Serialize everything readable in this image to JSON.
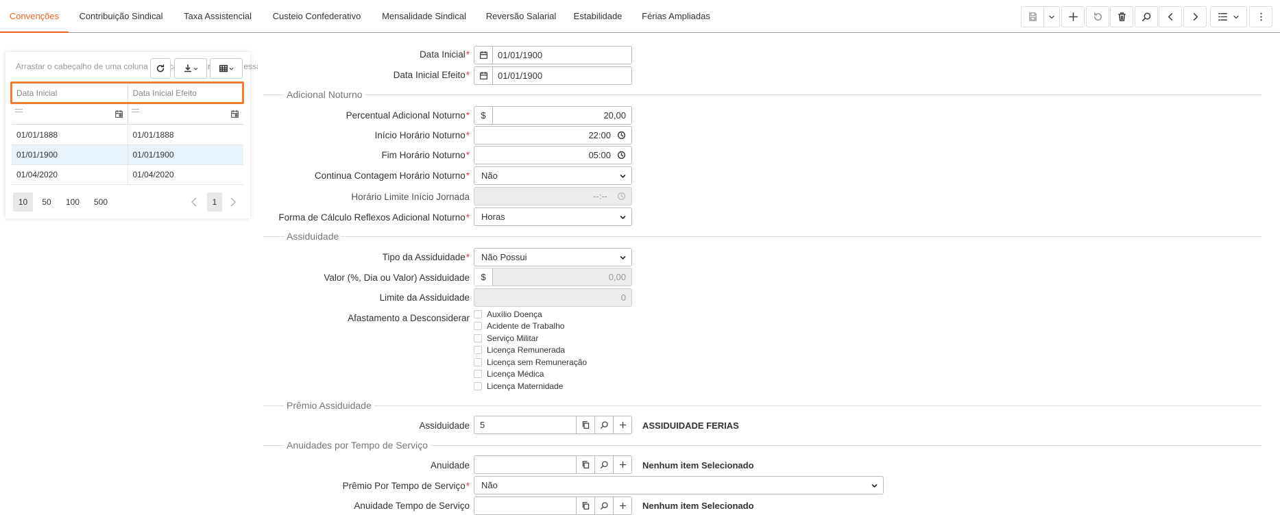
{
  "tabs": [
    "Convenções",
    "Contribuição Sindical",
    "Taxa Assistencial",
    "Custeio Confederativo",
    "Mensalidade Sindical",
    "Reversão Salarial",
    "Estabilidade",
    "Férias Ampliadas"
  ],
  "accent_color": "#f26522",
  "toolbar_icons": [
    "save-icon",
    "chevron-down-icon",
    "plus-icon",
    "undo-icon",
    "trash-icon",
    "search-icon",
    "chevron-left-icon",
    "chevron-right-icon",
    "list-icon",
    "chevron-down-icon",
    "more-vertical-icon"
  ],
  "grid": {
    "drag_hint": "Arrastar o cabeçalho de uma coluna para cá para agrupar por essa coluna",
    "columns": [
      "Data Inicial",
      "Data Inicial Efeito"
    ],
    "rows": [
      [
        "01/01/1888",
        "01/01/1888"
      ],
      [
        "01/01/1900",
        "01/01/1900"
      ],
      [
        "01/04/2020",
        "01/04/2020"
      ]
    ],
    "selected_row": 1,
    "page_sizes": [
      "10",
      "50",
      "100",
      "500"
    ],
    "current_page": "1"
  },
  "form": {
    "data_inicial": {
      "label": "Data Inicial",
      "value": "01/01/1900"
    },
    "data_inicial_efeito": {
      "label": "Data Inicial Efeito",
      "value": "01/01/1900"
    },
    "sec_adicional_noturno": "Adicional Noturno",
    "percentual": {
      "label": "Percentual Adicional Noturno",
      "prefix": "$",
      "value": "20,00"
    },
    "inicio_horario": {
      "label": "Início Horário Noturno",
      "value": "22:00"
    },
    "fim_horario": {
      "label": "Fim Horário Noturno",
      "value": "05:00"
    },
    "continua_contagem": {
      "label": "Continua Contagem Horário Noturno",
      "value": "Não"
    },
    "horario_limite": {
      "label": "Horário Limite Início Jornada",
      "value": "--:--"
    },
    "forma_calculo": {
      "label": "Forma de Cálculo Reflexos Adicional Noturno",
      "value": "Horas"
    },
    "sec_assiduidade": "Assiduidade",
    "tipo_assiduidade": {
      "label": "Tipo da Assiduidade",
      "value": "Não Possui"
    },
    "valor_assiduidade": {
      "label": "Valor (%, Dia ou Valor) Assiduidade",
      "prefix": "$",
      "value": "0,00"
    },
    "limite_assiduidade": {
      "label": "Limite da Assiduidade",
      "value": "0"
    },
    "afastamento": {
      "label": "Afastamento a Desconsiderar",
      "options": [
        "Auxílio Doença",
        "Acidente de Trabalho",
        "Serviço Militar",
        "Licença Remunerada",
        "Licença sem Remuneração",
        "Licença Médica",
        "Licença Maternidade"
      ]
    },
    "sec_premio_assiduidade": "Prêmio Assiduidade",
    "assiduidade": {
      "label": "Assiduidade",
      "value": "5",
      "desc": "ASSIDUIDADE FERIAS"
    },
    "sec_anuidades": "Anuidades por Tempo de Serviço",
    "anuidade": {
      "label": "Anuidade",
      "value": "",
      "desc": "Nenhum item Selecionado"
    },
    "premio_tempo": {
      "label": "Prêmio Por Tempo de Serviço",
      "value": "Não"
    },
    "anuidade_tempo": {
      "label": "Anuidade Tempo de Serviço",
      "value": "",
      "desc": "Nenhum item Selecionado"
    }
  }
}
